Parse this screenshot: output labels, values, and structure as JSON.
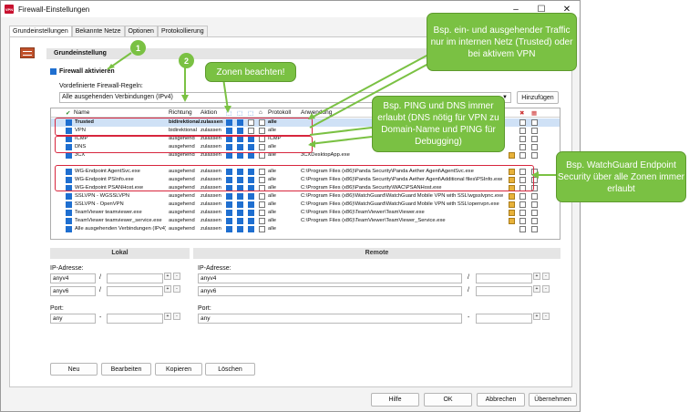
{
  "window": {
    "title": "Firewall-Einstellungen"
  },
  "tabs": [
    "Grundeinstellungen",
    "Bekannte Netze",
    "Optionen",
    "Protokollierung"
  ],
  "section_title": "Grundeinstellung",
  "enable_label": "Firewall aktivieren",
  "predefined_label": "Vordefinierte Firewall-Regeln:",
  "predefined_value": "Alle ausgehenden Verbindungen (IPv4)",
  "add_button": "Hinzufügen",
  "grid_headers": {
    "name": "Name",
    "richtung": "Richtung",
    "aktion": "Aktion",
    "protokoll": "Protokoll",
    "anwendung": "Anwendung"
  },
  "rules": [
    {
      "name": "Trusted",
      "richtung": "bidirektional",
      "aktion": "zulassen",
      "protokoll": "alle",
      "anwendung": ""
    },
    {
      "name": "VPN",
      "richtung": "bidirektional",
      "aktion": "zulassen",
      "protokoll": "alle",
      "anwendung": ""
    },
    {
      "name": "ICMP",
      "richtung": "ausgehend",
      "aktion": "zulassen",
      "protokoll": "ICMP",
      "anwendung": ""
    },
    {
      "name": "DNS",
      "richtung": "ausgehend",
      "aktion": "zulassen",
      "protokoll": "alle",
      "anwendung": ""
    },
    {
      "name": "3CX",
      "richtung": "ausgehend",
      "aktion": "zulassen",
      "protokoll": "alle",
      "anwendung": "3CXDesktopApp.exe"
    },
    {
      "name": "",
      "richtung": "",
      "aktion": "",
      "protokoll": "",
      "anwendung": ""
    },
    {
      "name": "WG-Endpoint AgentSvc.exe",
      "richtung": "ausgehend",
      "aktion": "zulassen",
      "protokoll": "alle",
      "anwendung": "C:\\Program Files (x86)\\Panda Security\\Panda Aether Agent\\AgentSvc.exe"
    },
    {
      "name": "WG-Endpoint PSInfo.exe",
      "richtung": "ausgehend",
      "aktion": "zulassen",
      "protokoll": "alle",
      "anwendung": "C:\\Program Files (x86)\\Panda Security\\Panda Aether Agent\\Additional files\\PSInfo.exe"
    },
    {
      "name": "WG-Endpoint PSANHost.exe",
      "richtung": "ausgehend",
      "aktion": "zulassen",
      "protokoll": "alle",
      "anwendung": "C:\\Program Files (x86)\\Panda Security\\WAC\\PSANHost.exe"
    },
    {
      "name": "SSLVPN - WGSSLVPN",
      "richtung": "ausgehend",
      "aktion": "zulassen",
      "protokoll": "alle",
      "anwendung": "C:\\Program Files (x86)\\WatchGuard\\WatchGuard Mobile VPN with SSL\\wgsslvpnc.exe"
    },
    {
      "name": "SSLVPN - OpenVPN",
      "richtung": "ausgehend",
      "aktion": "zulassen",
      "protokoll": "alle",
      "anwendung": "C:\\Program Files (x86)\\WatchGuard\\WatchGuard Mobile VPN with SSL\\openvpn.exe"
    },
    {
      "name": "TeamViewer teamviewer.exe",
      "richtung": "ausgehend",
      "aktion": "zulassen",
      "protokoll": "alle",
      "anwendung": "C:\\Program Files (x86)\\TeamViewer\\TeamViewer.exe"
    },
    {
      "name": "TeamViewer teamviewer_service.exe",
      "richtung": "ausgehend",
      "aktion": "zulassen",
      "protokoll": "alle",
      "anwendung": "C:\\Program Files (x86)\\TeamViewer\\TeamViewer_Service.exe"
    },
    {
      "name": "Alle ausgehenden Verbindungen (IPv4)",
      "richtung": "ausgehend",
      "aktion": "zulassen",
      "protokoll": "alle",
      "anwendung": ""
    }
  ],
  "lokal": {
    "header": "Lokal",
    "ip_label": "IP-Adresse:",
    "ip4": "anyv4",
    "ip6": "anyv6",
    "port_label": "Port:",
    "port": "any",
    "slash": "/",
    "dash": "-"
  },
  "remote": {
    "header": "Remote",
    "ip_label": "IP-Adresse:",
    "ip4": "anyv4",
    "ip6": "anyv6",
    "port_label": "Port:",
    "port": "any",
    "slash": "/",
    "dash": "-"
  },
  "row_buttons": [
    "Neu",
    "Bearbeiten",
    "Kopieren",
    "Löschen"
  ],
  "footer_buttons": [
    "Hilfe",
    "OK",
    "Abbrechen",
    "Übernehmen"
  ],
  "callouts": {
    "c1": "Bsp. ein- und ausgehender Traffic nur im internen Netz (Trusted) oder bei aktivem VPN",
    "c2": "Zonen beachten!",
    "c3": "Bsp. PING und DNS immer erlaubt (DNS nötig für VPN zu Domain-Name und PING für Debugging)",
    "c4": "Bsp. WatchGuard Endpoint Security über alle Zonen immer erlaubt",
    "n1": "1",
    "n2": "2"
  },
  "accent_color": "#7ac143",
  "highlight_color": "#d7263d"
}
